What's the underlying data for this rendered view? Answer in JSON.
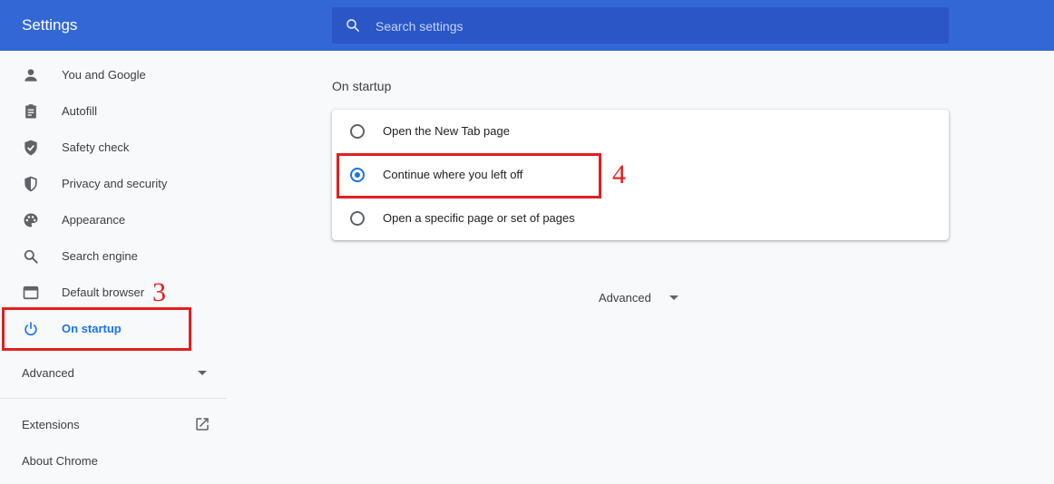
{
  "app": {
    "title": "Settings"
  },
  "search": {
    "placeholder": "Search settings"
  },
  "sidebar": {
    "items": [
      {
        "label": "You and Google",
        "icon": "person-icon"
      },
      {
        "label": "Autofill",
        "icon": "clipboard-icon"
      },
      {
        "label": "Safety check",
        "icon": "shield-check-icon"
      },
      {
        "label": "Privacy and security",
        "icon": "shield-icon"
      },
      {
        "label": "Appearance",
        "icon": "palette-icon"
      },
      {
        "label": "Search engine",
        "icon": "search-icon"
      },
      {
        "label": "Default browser",
        "icon": "browser-icon"
      },
      {
        "label": "On startup",
        "icon": "power-icon",
        "active": true
      }
    ],
    "advanced": "Advanced",
    "extensions": "Extensions",
    "about": "About Chrome"
  },
  "main": {
    "section_title": "On startup",
    "options": [
      {
        "label": "Open the New Tab page",
        "checked": false
      },
      {
        "label": "Continue where you left off",
        "checked": true
      },
      {
        "label": "Open a specific page or set of pages",
        "checked": false
      }
    ],
    "advanced": "Advanced"
  },
  "annotations": {
    "step3": "3",
    "step4": "4"
  },
  "colors": {
    "header": "#3367d6",
    "search_bg": "#2a56c6",
    "accent": "#1a73e8",
    "annotation": "#e02020",
    "background": "#f8f9fa"
  }
}
